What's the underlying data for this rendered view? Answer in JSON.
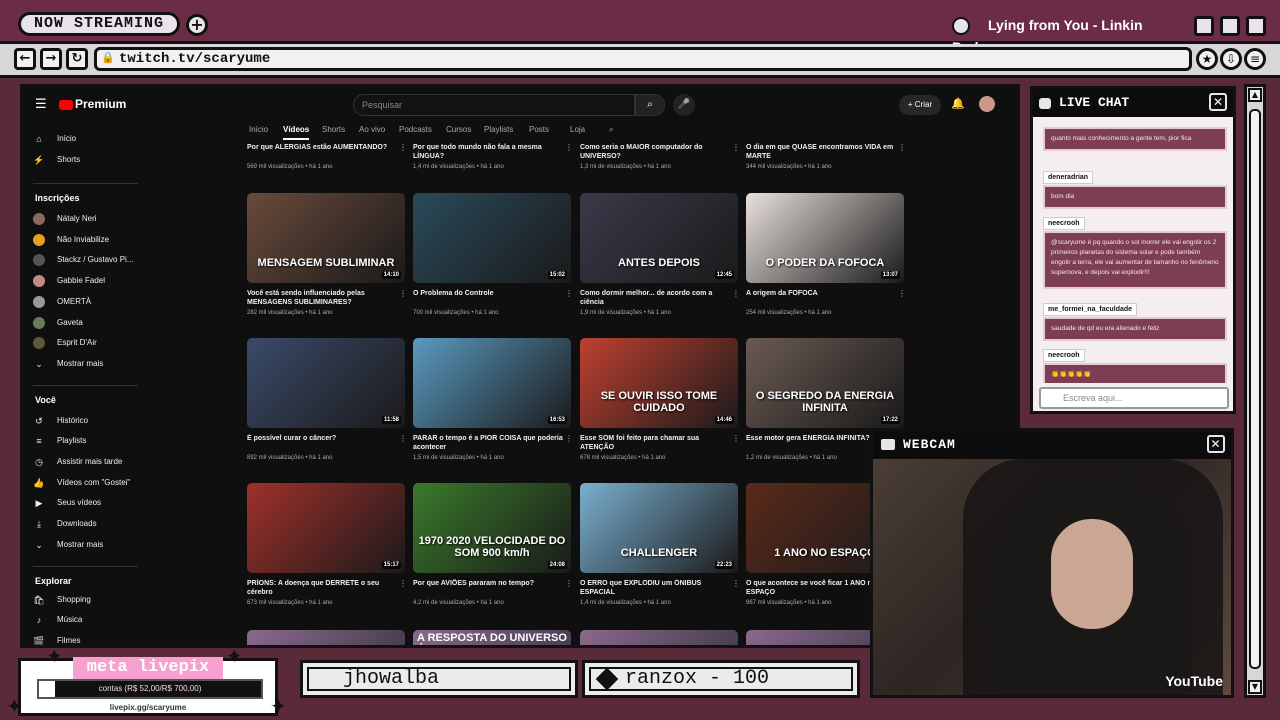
{
  "overlay": {
    "now_streaming": "NOW STREAMING",
    "song": "Lying from You - Linkin Park",
    "url": "twitch.tv/scaryume"
  },
  "youtube": {
    "logo": "Premium",
    "search_placeholder": "Pesquisar",
    "create_label": "Criar",
    "sidebar": {
      "main": [
        {
          "label": "Início",
          "icon": "home-icon"
        },
        {
          "label": "Shorts",
          "icon": "shorts-icon"
        }
      ],
      "subs_header": "Inscrições",
      "subs": [
        {
          "label": "Nátaly Neri",
          "color": "#8a6a5a"
        },
        {
          "label": "Não Inviabilize",
          "color": "#e5a020"
        },
        {
          "label": "Stackz / Gustavo Pi...",
          "color": "#555555"
        },
        {
          "label": "Gabbie Fadel",
          "color": "#c08a8a"
        },
        {
          "label": "OMERTÀ",
          "color": "#999999"
        },
        {
          "label": "Gaveta",
          "color": "#6a7a5a"
        },
        {
          "label": "Esprit D'Air",
          "color": "#5a5a3a"
        },
        {
          "label": "Mostrar mais",
          "color": ""
        }
      ],
      "you_header": "Você",
      "you": [
        {
          "label": "Histórico"
        },
        {
          "label": "Playlists"
        },
        {
          "label": "Assistir mais tarde"
        },
        {
          "label": "Vídeos com \"Gostei\""
        },
        {
          "label": "Seus vídeos"
        },
        {
          "label": "Downloads"
        },
        {
          "label": "Mostrar mais"
        }
      ],
      "explore_header": "Explorar",
      "explore": [
        {
          "label": "Shopping"
        },
        {
          "label": "Música"
        },
        {
          "label": "Filmes"
        }
      ]
    },
    "tabs": [
      "Início",
      "Vídeos",
      "Shorts",
      "Ao vivo",
      "Podcasts",
      "Cursos",
      "Playlists",
      "Posts",
      "Loja"
    ],
    "top_row": [
      {
        "title": "Por que ALERGIAS estão AUMENTANDO?",
        "meta": "569 mil visualizações • há 1 ano"
      },
      {
        "title": "Por que todo mundo não fala a mesma LÍNGUA?",
        "meta": "1,4 mi de visualizações • há 1 ano"
      },
      {
        "title": "Como seria o MAIOR computador do UNIVERSO?",
        "meta": "1,3 mi de visualizações • há 1 ano"
      },
      {
        "title": "O dia em que QUASE encontramos VIDA em MARTE",
        "meta": "344 mil visualizações • há 1 ano"
      }
    ],
    "videos": [
      {
        "title": "Você está sendo influenciado pelas MENSAGENS SUBLIMINARES?",
        "meta": "282 mil visualizações • há 1 ano",
        "duration": "14:10",
        "thumb_text": "MENSAGEM SUBLIMINAR",
        "bg": "#6a4a3a"
      },
      {
        "title": "O Problema do Controle",
        "meta": "700 mil visualizações • há 1 ano",
        "duration": "15:02",
        "thumb_text": "",
        "bg": "#2a4a5a"
      },
      {
        "title": "Como dormir melhor... de acordo com a ciência",
        "meta": "1,9 mi de visualizações • há 1 ano",
        "duration": "12:45",
        "thumb_text": "ANTES DEPOIS",
        "bg": "#3a3a4a"
      },
      {
        "title": "A origem da FOFOCA",
        "meta": "254 mil visualizações • há 1 ano",
        "duration": "13:07",
        "thumb_text": "O PODER DA FOFOCA",
        "bg": "#e8e0dc"
      },
      {
        "title": "É possível curar o câncer?",
        "meta": "892 mil visualizações • há 1 ano",
        "duration": "11:58",
        "thumb_text": "",
        "bg": "#3a4a6a"
      },
      {
        "title": "PARAR o tempo é a PIOR COISA que poderia acontecer",
        "meta": "1,5 mi de visualizações • há 1 ano",
        "duration": "16:53",
        "thumb_text": "",
        "bg": "#5a9ac0"
      },
      {
        "title": "Esse SOM foi feito para chamar sua ATENÇÃO",
        "meta": "678 mil visualizações • há 1 ano",
        "duration": "14:46",
        "thumb_text": "SE OUVIR ISSO TOME CUIDADO",
        "bg": "#c04030"
      },
      {
        "title": "Esse motor gera ENERGIA INFINITA?",
        "meta": "1,2 mi de visualizações • há 1 ano",
        "duration": "17:22",
        "thumb_text": "O SEGREDO DA ENERGIA INFINITA",
        "bg": "#6a5a52"
      },
      {
        "title": "PRÍONS: A doença que DERRETE o seu cérebro",
        "meta": "673 mil visualizações • há 1 ano",
        "duration": "15:17",
        "thumb_text": "",
        "bg": "#a0302a"
      },
      {
        "title": "Por que AVIÕES pararam no tempo?",
        "meta": "4,2 mi de visualizações • há 1 ano",
        "duration": "24:08",
        "thumb_text": "1970 2020 VELOCIDADE DO SOM 900 km/h",
        "bg": "#3a7a2a"
      },
      {
        "title": "O ERRO que EXPLODIU um ÔNIBUS ESPACIAL",
        "meta": "1,4 mi de visualizações • há 1 ano",
        "duration": "22:23",
        "thumb_text": "CHALLENGER",
        "bg": "#7ab0d0"
      },
      {
        "title": "O que acontece se você ficar 1 ANO no ESPAÇO",
        "meta": "967 mil visualizações • há 1 ano",
        "duration": "",
        "thumb_text": "1 ANO NO ESPAÇO",
        "bg": "#5a2a1a"
      }
    ],
    "bottom_row_thumb_text": [
      "",
      "A RESPOSTA DO UNIVERSO É",
      "",
      ""
    ]
  },
  "chat": {
    "title": "LIVE CHAT",
    "input_placeholder": "Escreva aqui...",
    "messages": [
      {
        "user": "",
        "text": "quanto mais conhecimento a gente tem, pior fica"
      },
      {
        "user": "deneradrian",
        "text": "bom dia"
      },
      {
        "user": "neecrooh",
        "text": "@scaryume é pq quando o sol morrer ele vai engolir os 2 primeiros planetas do sistema solar e pode também engolir a terra, ele vai aumentar de tamanho no fenômeno supernova, e depois vai explodir!!!"
      },
      {
        "user": "me_formei_na_faculdade",
        "text": "saudade de qd eu era alienado e feliz"
      },
      {
        "user": "neecrooh",
        "text": "👏👏👏👏👏"
      }
    ]
  },
  "webcam": {
    "title": "WEBCAM",
    "watermark": "YouTube"
  },
  "livepix": {
    "title": "meta livepix",
    "progress_text": "contas (R$ 52,00/R$ 700,00)",
    "progress": 0.074,
    "url": "livepix.gg/scaryume"
  },
  "donors": [
    {
      "name": "jhowalba"
    },
    {
      "name": "ranzox - 100"
    }
  ]
}
